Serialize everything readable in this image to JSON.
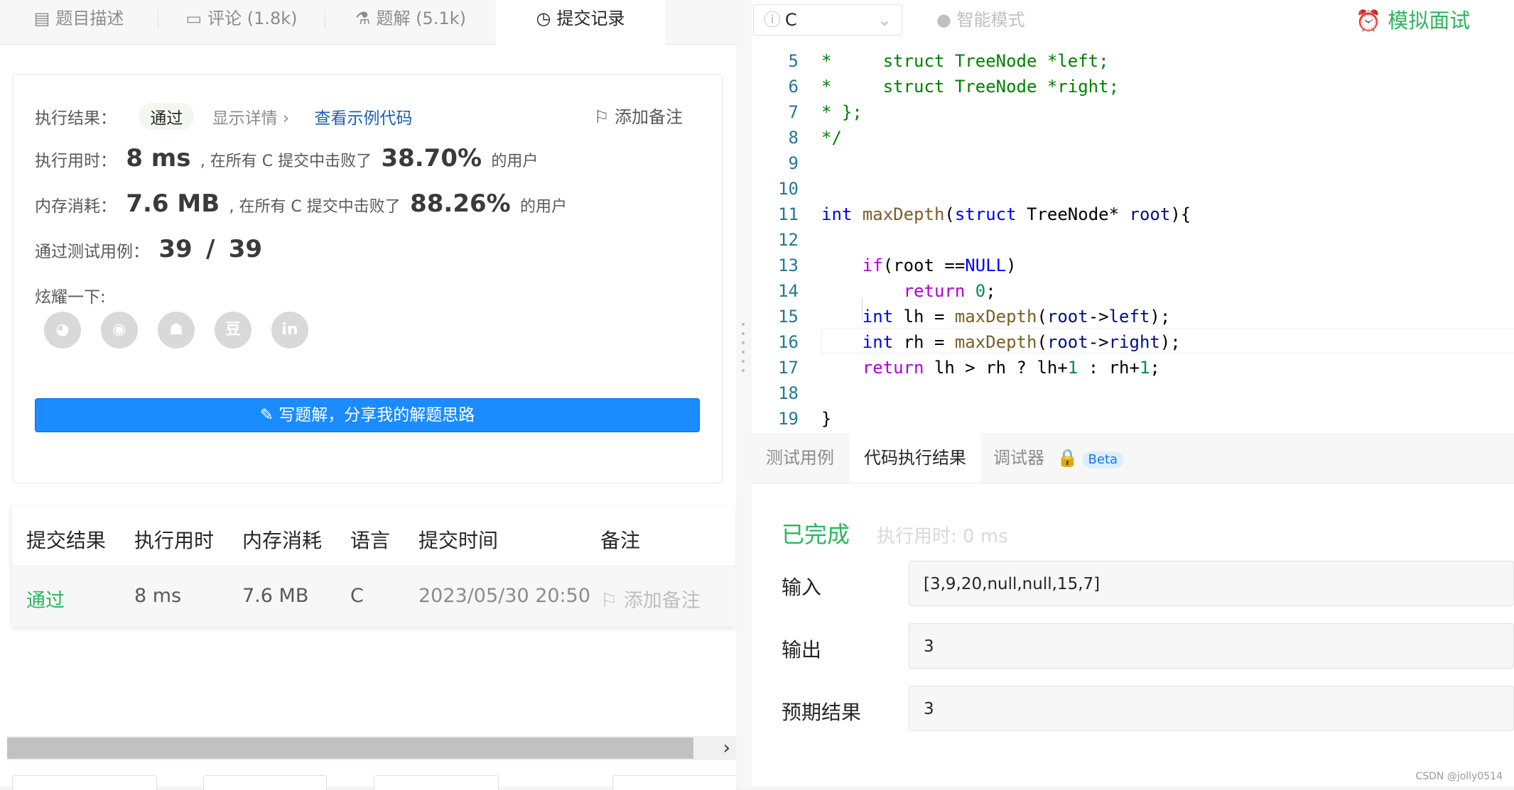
{
  "tabs": [
    {
      "label": "题目描述",
      "icon": "description-icon"
    },
    {
      "label": "评论 (1.8k)",
      "icon": "comment-icon"
    },
    {
      "label": "题解 (5.1k)",
      "icon": "flask-icon"
    },
    {
      "label": "提交记录",
      "icon": "clock-icon"
    }
  ],
  "result": {
    "label": "执行结果：",
    "status": "通过",
    "show_details": "显示详情",
    "view_sample": "查看示例代码",
    "add_note": "添加备注",
    "time_label": "执行用时：",
    "time_value": "8 ms",
    "time_mid": ", 在所有 C 提交中击败了",
    "time_pct": "38.70%",
    "users": "的用户",
    "mem_label": "内存消耗：",
    "mem_value": "7.6 MB",
    "mem_mid": ", 在所有 C 提交中击败了",
    "mem_pct": "88.26%",
    "cases_label": "通过测试用例：",
    "cases_passed": "39",
    "cases_sep": "/",
    "cases_total": "39",
    "share_label": "炫耀一下:",
    "write_btn": "写题解，分享我的解题思路"
  },
  "submissions": {
    "headers": [
      "提交结果",
      "执行用时",
      "内存消耗",
      "语言",
      "提交时间",
      "备注"
    ],
    "rows": [
      {
        "result": "通过",
        "time": "8 ms",
        "memory": "7.6 MB",
        "lang": "C",
        "submitted": "2023/05/30 20:50",
        "note": "添加备注"
      }
    ]
  },
  "editor": {
    "language": "C",
    "smart_mode": "智能模式",
    "mock_interview": "模拟面试",
    "line_numbers": [
      "5",
      "6",
      "7",
      "8",
      "9",
      "10",
      "11",
      "12",
      "13",
      "14",
      "15",
      "16",
      "17",
      "18",
      "19"
    ]
  },
  "result_panel": {
    "tabs": [
      "测试用例",
      "代码执行结果",
      "调试器"
    ],
    "beta": "Beta",
    "status": "已完成",
    "exec_time": "执行用时: 0 ms",
    "input_label": "输入",
    "input_value": "[3,9,20,null,null,15,7]",
    "output_label": "输出",
    "output_value": "3",
    "expected_label": "预期结果",
    "expected_value": "3"
  },
  "watermark": "CSDN @jolly0514",
  "colors": {
    "accent": "#1a8cff",
    "success": "#2db55d",
    "link": "#1a5fb4"
  }
}
